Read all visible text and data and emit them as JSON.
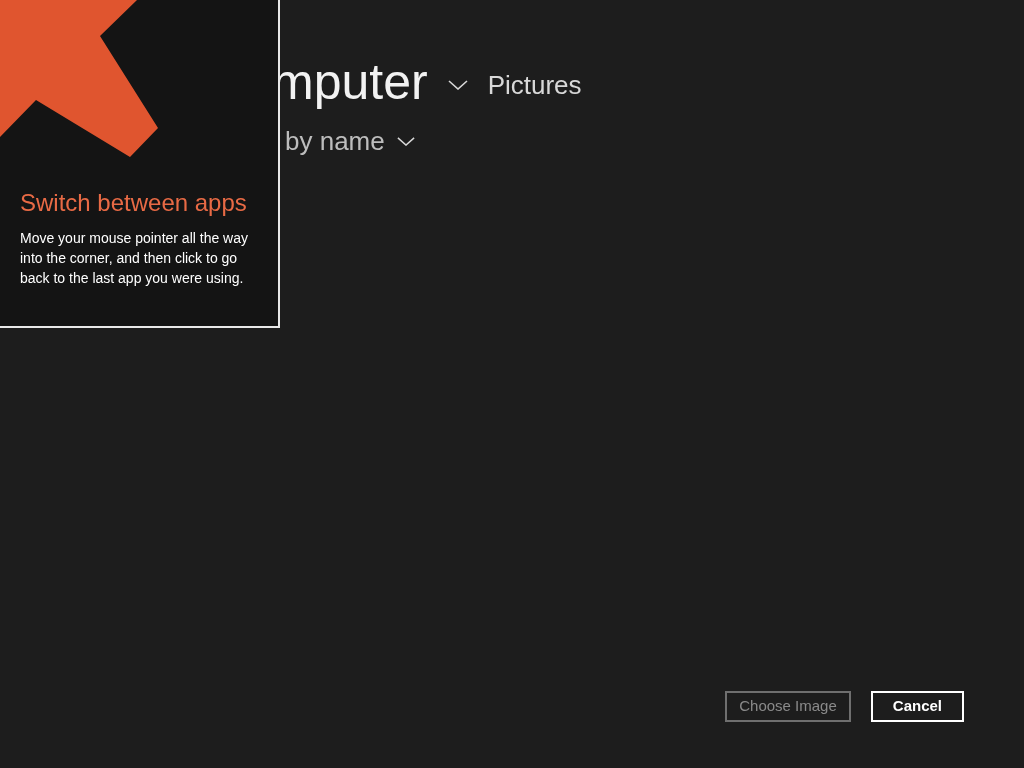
{
  "header": {
    "title": "mputer",
    "location": "Pictures"
  },
  "sort": {
    "label": "by name"
  },
  "tip": {
    "title": "Switch between apps",
    "body": "Move your mouse pointer all the way into the corner, and then click to go back to the last app you were using."
  },
  "buttons": [
    {
      "label": "Choose Image",
      "disabled": true
    },
    {
      "label": "Cancel",
      "disabled": false
    }
  ]
}
